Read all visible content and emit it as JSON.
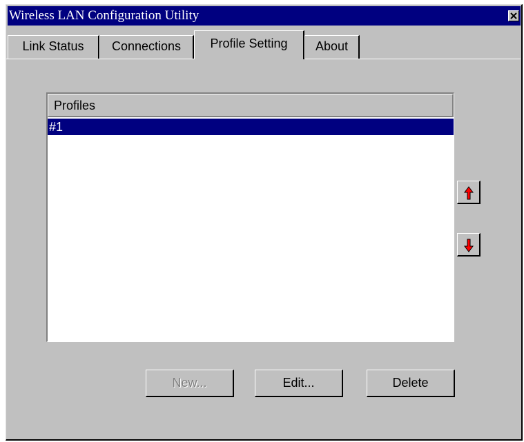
{
  "window": {
    "title": "Wireless LAN Configuration Utility"
  },
  "tabs": [
    {
      "label": "Link Status",
      "active": false
    },
    {
      "label": "Connections",
      "active": false
    },
    {
      "label": "Profile Setting",
      "active": true
    },
    {
      "label": "About",
      "active": false
    }
  ],
  "profiles": {
    "header": "Profiles",
    "items": [
      {
        "label": "#1",
        "selected": true
      }
    ]
  },
  "buttons": {
    "new_label": "New...",
    "new_enabled": false,
    "edit_label": "Edit...",
    "delete_label": "Delete"
  },
  "icons": {
    "close": "close-icon",
    "up": "arrow-up-icon",
    "down": "arrow-down-icon"
  },
  "colors": {
    "titlebar": "#000080",
    "face": "#c0c0c0",
    "selection": "#000080",
    "arrow": "#ff0000"
  }
}
